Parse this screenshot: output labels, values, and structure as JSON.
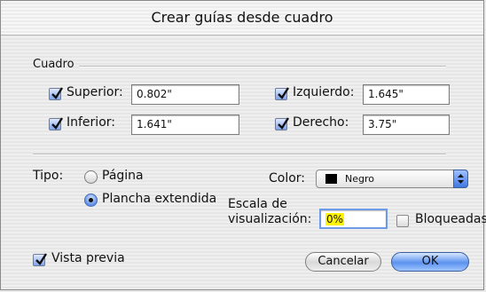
{
  "window": {
    "title": "Crear guías desde cuadro"
  },
  "cuadro": {
    "group_label": "Cuadro",
    "superior": {
      "label": "Superior:",
      "value": "0.802\"",
      "checked": true
    },
    "izquierdo": {
      "label": "Izquierdo:",
      "value": "1.645\"",
      "checked": true
    },
    "inferior": {
      "label": "Inferior:",
      "value": "1.641\"",
      "checked": true
    },
    "derecho": {
      "label": "Derecho:",
      "value": "3.75\"",
      "checked": true
    }
  },
  "tipo": {
    "label": "Tipo:",
    "options": [
      {
        "label": "Página",
        "selected": false
      },
      {
        "label": "Plancha extendida",
        "selected": true
      }
    ]
  },
  "color": {
    "label": "Color:",
    "selected": "Negro",
    "swatch": "#000000"
  },
  "escala": {
    "label_line1": "Escala de",
    "label_line2": "visualización:",
    "value": "0%"
  },
  "bloqueadas": {
    "label": "Bloqueadas",
    "checked": false
  },
  "vista_previa": {
    "label": "Vista previa",
    "checked": true
  },
  "buttons": {
    "cancel": "Cancelar",
    "ok": "OK"
  }
}
